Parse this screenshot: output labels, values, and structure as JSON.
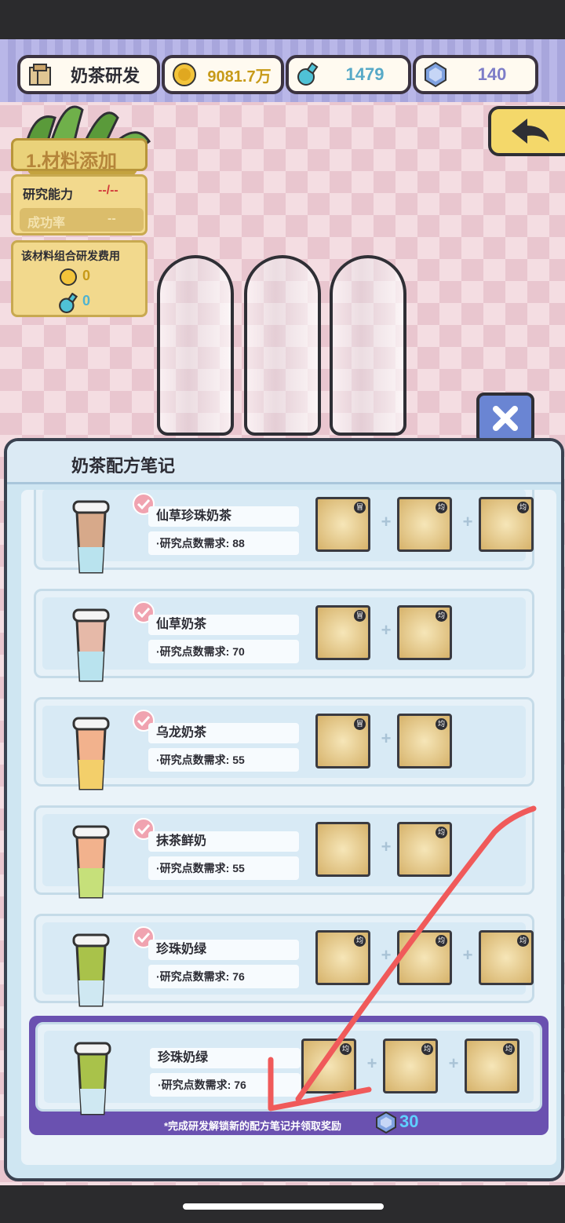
{
  "header": {
    "title": "奶茶研发",
    "coins": "9081.7万",
    "potions": "1479",
    "gems": "140"
  },
  "left_panel": {
    "step_title": "1.材料添加",
    "research_ability_label": "研究能力",
    "research_ability_value": "--/--",
    "success_rate_label": "成功率",
    "success_rate_value": "--",
    "cost_title": "该材料组合研发费用",
    "cost_coins": "0",
    "cost_potions": "0"
  },
  "modal": {
    "title": "奶茶配方笔记",
    "recipes": [
      {
        "name": "仙草珍珠奶茶",
        "requirement": "·研究点数需求: 88",
        "completed": true
      },
      {
        "name": "仙草奶茶",
        "requirement": "·研究点数需求: 70",
        "completed": true
      },
      {
        "name": "乌龙奶茶",
        "requirement": "·研究点数需求: 55",
        "completed": true
      },
      {
        "name": "抹茶鲜奶",
        "requirement": "·研究点数需求: 55",
        "completed": true
      },
      {
        "name": "珍珠奶绿",
        "requirement": "·研究点数需求: 76",
        "completed": true
      },
      {
        "name": "珍珠奶绿",
        "requirement": "·研究点数需求: 76",
        "completed": false
      }
    ],
    "hint": "*完成研发解锁新的配方笔记并领取奖励",
    "reward": "30"
  },
  "icons": {
    "tag_all": "均",
    "tag_grass": "冒"
  }
}
